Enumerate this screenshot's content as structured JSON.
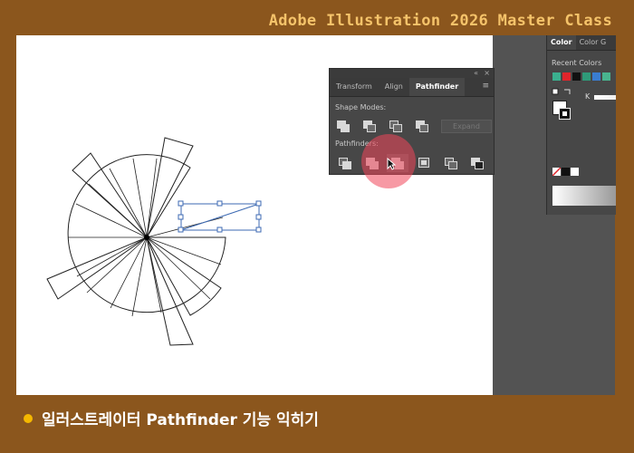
{
  "header": {
    "brand": "Adobe Illustration 2026 Master Class"
  },
  "pathfinder_panel": {
    "tabs": [
      {
        "label": "Transform",
        "active": false
      },
      {
        "label": "Align",
        "active": false
      },
      {
        "label": "Pathfinder",
        "active": true
      }
    ],
    "collapse": "«",
    "close": "×",
    "menu": "≡",
    "shape_modes_label": "Shape Modes:",
    "expand_label": "Expand",
    "pathfinders_label": "Pathfinders:"
  },
  "color_panel": {
    "tabs": [
      {
        "label": "Color",
        "active": true
      },
      {
        "label": "Color G",
        "active": false
      }
    ],
    "recent_colors_label": "Recent Colors",
    "recent_colors": [
      "#3bb08f",
      "#e0252b",
      "#111111",
      "#2f9a79",
      "#3a7dd0",
      "#49b48f"
    ],
    "channel_label": "K"
  },
  "footer": {
    "caption": "일러스트레이터 Pathfinder 기능 익히기"
  },
  "colors": {
    "accent": "#F5C36A",
    "background": "#8B561D",
    "bullet": "#F5B800"
  }
}
